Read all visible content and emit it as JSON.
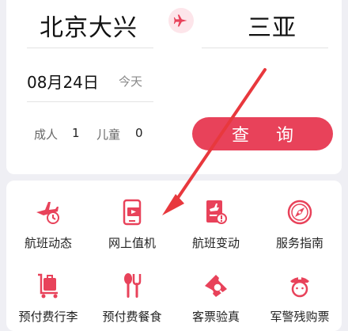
{
  "search": {
    "from_city": "北京大兴",
    "to_city": "三亚",
    "date": "08月24日",
    "weekday": "今天",
    "adult_label": "成人",
    "adult_count": "1",
    "child_label": "儿童",
    "child_count": "0",
    "search_label": "查询"
  },
  "services": [
    {
      "label": "航班动态",
      "icon": "plane-clock-icon"
    },
    {
      "label": "网上值机",
      "icon": "phone-ticket-icon"
    },
    {
      "label": "航班变动",
      "icon": "ticket-alert-icon"
    },
    {
      "label": "服务指南",
      "icon": "compass-icon"
    },
    {
      "label": "预付费行李",
      "icon": "luggage-icon"
    },
    {
      "label": "预付费餐食",
      "icon": "meal-icon"
    },
    {
      "label": "客票验真",
      "icon": "ticket-search-icon"
    },
    {
      "label": "军警残购票",
      "icon": "officer-icon"
    }
  ],
  "colors": {
    "accent": "#e8425a",
    "background": "#efeff4"
  }
}
